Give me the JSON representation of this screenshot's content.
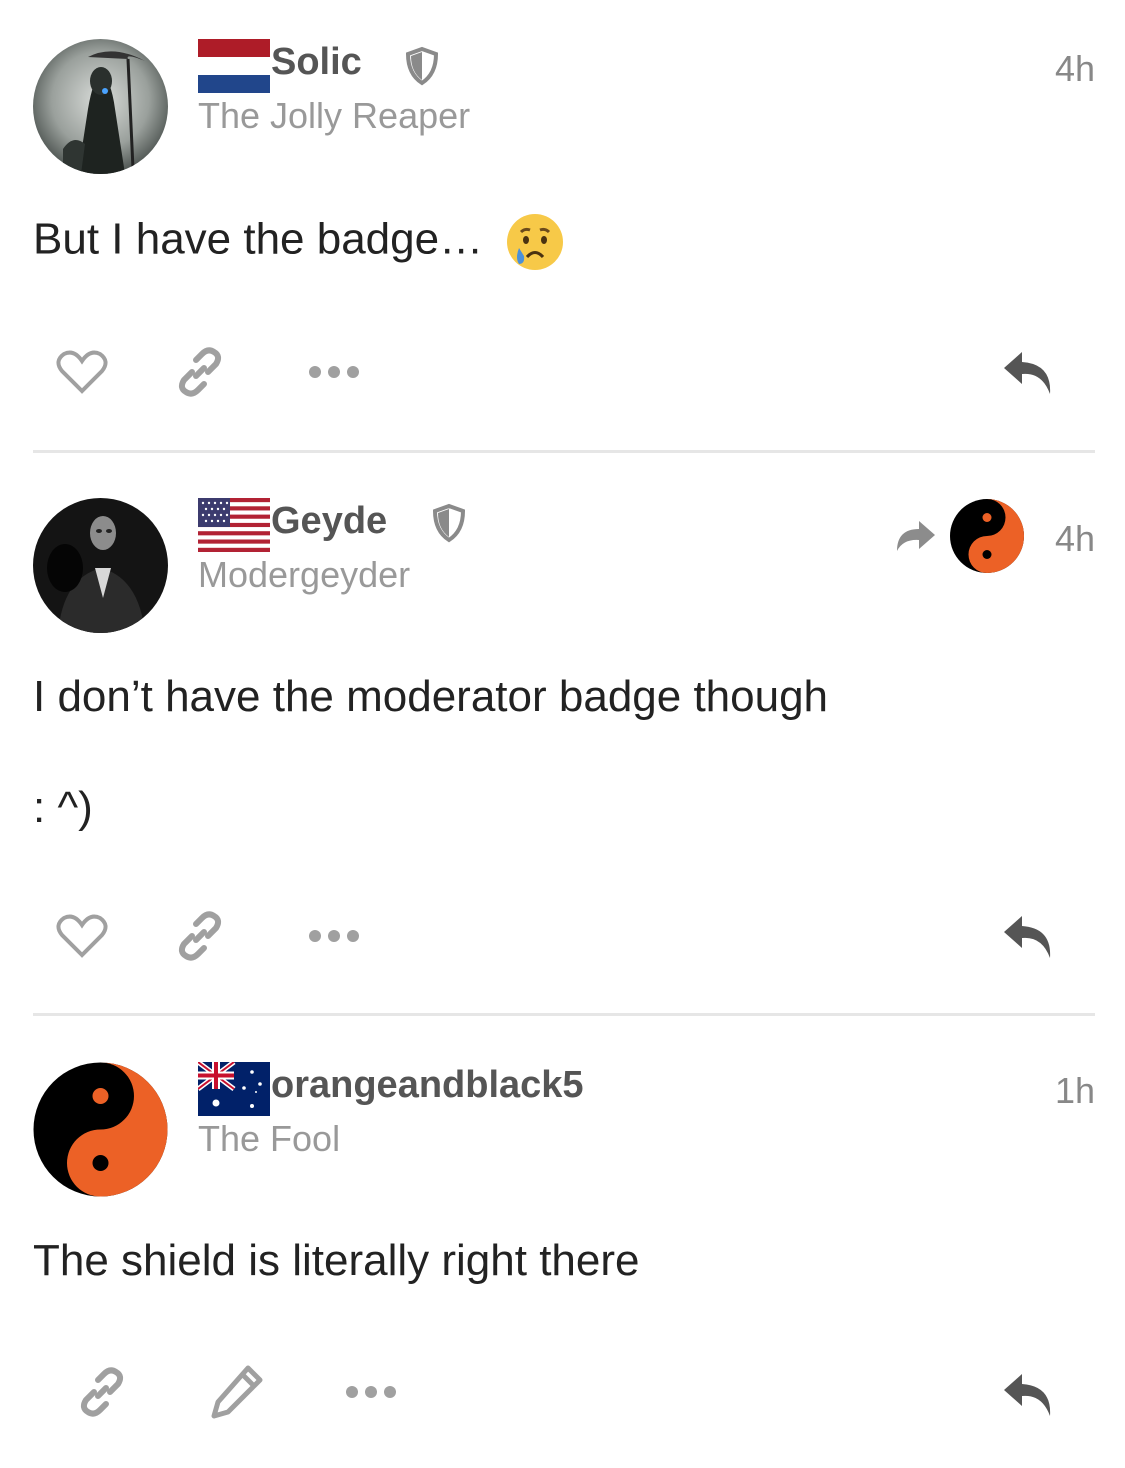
{
  "colors": {
    "text": "#222222",
    "muted": "#999999",
    "icon": "#a0a0a0",
    "username": "#555555",
    "divider": "#e6e6e6",
    "orange": "#ec6126"
  },
  "posts": [
    {
      "username": "Solic",
      "user_title": "The Jolly Reaper",
      "time": "4h",
      "flag": "netherlands-flag",
      "avatar": "reaper-avatar",
      "body": [
        "But I have the badge…"
      ],
      "emoji": "😢",
      "actions": [
        "heart-icon",
        "link-icon",
        "more-icon",
        "reply-icon"
      ]
    },
    {
      "username": "Geyde",
      "user_title": "Modergeyder",
      "time": "4h",
      "flag": "usa-flag",
      "avatar": "suit-figure-avatar",
      "reply_to_avatar": "yin-yang-avatar",
      "body": [
        "I don’t have the moderator badge though",
        ": ^)"
      ],
      "actions": [
        "heart-icon",
        "link-icon",
        "more-icon",
        "reply-icon"
      ]
    },
    {
      "username": "orangeandblack5",
      "user_title": "The Fool",
      "time": "1h",
      "flag": "australia-flag",
      "avatar": "yin-yang-avatar",
      "body": [
        "The shield is literally right there"
      ],
      "actions": [
        "link-icon",
        "edit-icon",
        "more-icon",
        "reply-icon"
      ]
    }
  ]
}
